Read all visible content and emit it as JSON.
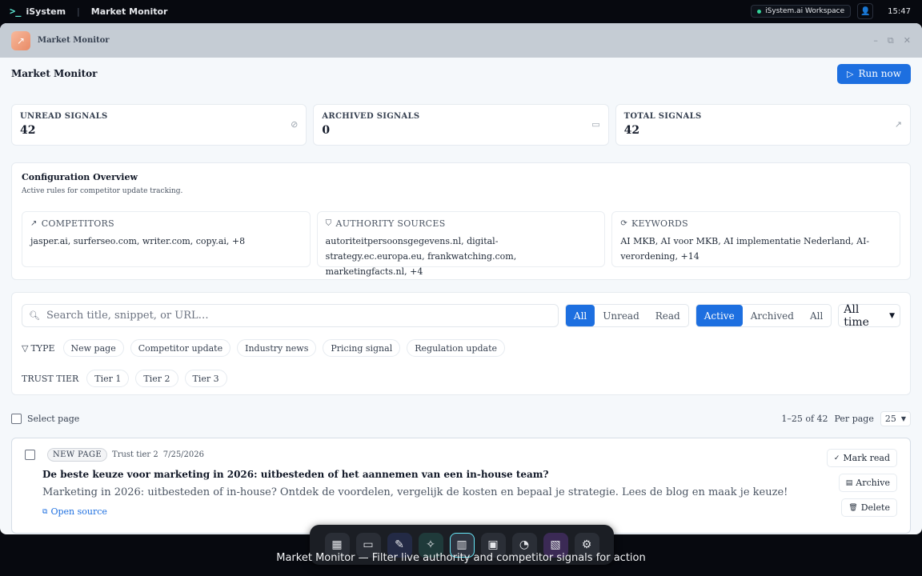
{
  "system": {
    "brand": "iSystem",
    "app_title": "Market Monitor",
    "workspace": "iSystem.ai Workspace",
    "time": "15:47"
  },
  "window": {
    "title": "Market Monitor",
    "controls": {
      "minimize": "–",
      "maximize": "⧉",
      "close": "✕"
    }
  },
  "header": {
    "title": "Market Monitor",
    "run_label": "Run now"
  },
  "stats": [
    {
      "label": "UNREAD SIGNALS",
      "value": "42",
      "icon": "eye-off-icon"
    },
    {
      "label": "ARCHIVED SIGNALS",
      "value": "0",
      "icon": "archive-icon"
    },
    {
      "label": "TOTAL SIGNALS",
      "value": "42",
      "icon": "trending-up-icon"
    }
  ],
  "config": {
    "title": "Configuration Overview",
    "subtitle": "Active rules for competitor update tracking.",
    "cards": [
      {
        "label": "COMPETITORS",
        "value": "jasper.ai, surferseo.com, writer.com, copy.ai, +8",
        "icon": "trending-up-icon"
      },
      {
        "label": "AUTHORITY SOURCES",
        "value": "autoriteitpersoonsgegevens.nl, digital-strategy.ec.europa.eu, frankwatching.com, marketingfacts.nl, +4",
        "icon": "shield-icon"
      },
      {
        "label": "KEYWORDS",
        "value": "AI MKB, AI voor MKB, AI implementatie Nederland, AI-verordening, +14",
        "icon": "refresh-icon"
      }
    ]
  },
  "filters": {
    "search_placeholder": "Search title, snippet, or URL…",
    "read_filter": {
      "options": [
        "All",
        "Unread",
        "Read"
      ],
      "selected": "All"
    },
    "status_filter": {
      "options": [
        "Active",
        "Archived",
        "All"
      ],
      "selected": "Active"
    },
    "time_select": "All time",
    "type_label": "TYPE",
    "type_chips": [
      "New page",
      "Competitor update",
      "Industry news",
      "Pricing signal",
      "Regulation update"
    ],
    "tier_label": "TRUST TIER",
    "tier_chips": [
      "Tier 1",
      "Tier 2",
      "Tier 3"
    ]
  },
  "list": {
    "select_page": "Select page",
    "range": "1–25 of 42",
    "per_page_label": "Per page",
    "per_page": "25"
  },
  "signals": [
    {
      "type": "NEW PAGE",
      "tier": "Trust tier 2",
      "date": "7/25/2026",
      "title": "De beste keuze voor marketing in 2026: uitbesteden of het aannemen van een in-house team?",
      "snippet": "Marketing in 2026: uitbesteden of in-house? Ontdek de voordelen, vergelijk de kosten en bepaal je strategie. Lees de blog en maak je keuze!",
      "link": "Open source",
      "actions": {
        "mark_read": "Mark read",
        "archive": "Archive",
        "delete": "Delete"
      }
    }
  ],
  "dock": [
    "grid-icon",
    "monitor-icon",
    "pen-tool-icon",
    "sparkles-icon",
    "bar-chart-icon",
    "briefcase-icon",
    "gauge-icon",
    "clapperboard-icon",
    "settings-icon"
  ],
  "caption": "Market Monitor — Filter live authority and competitor signals for action"
}
